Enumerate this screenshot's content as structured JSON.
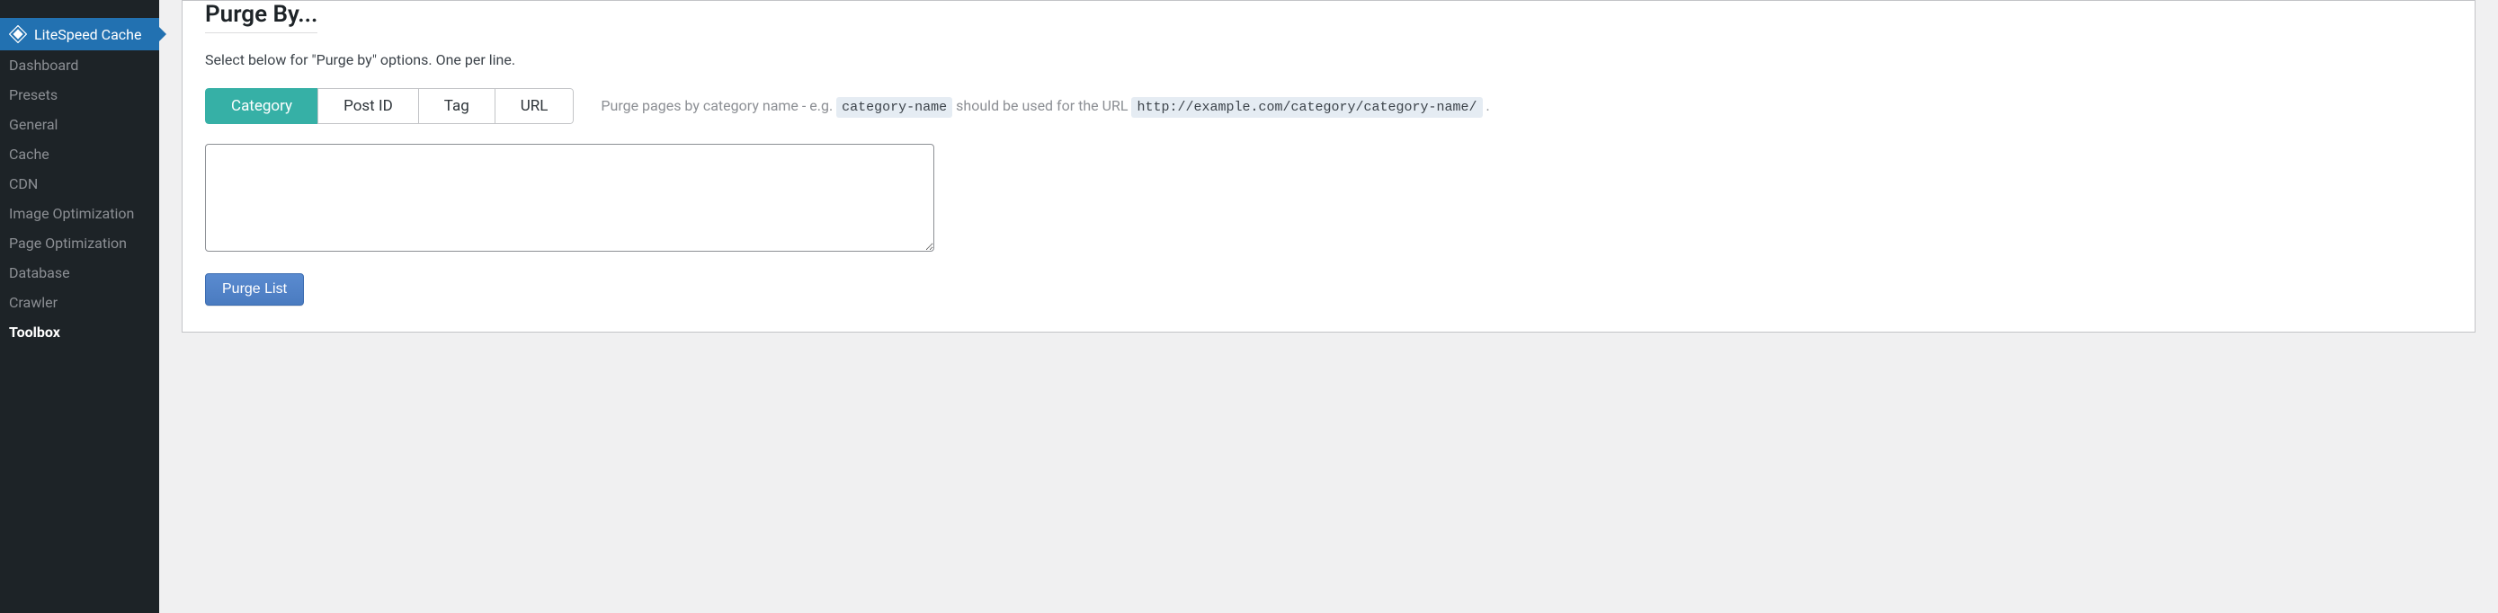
{
  "sidebar": {
    "header": "LiteSpeed Cache",
    "items": [
      {
        "label": "Dashboard"
      },
      {
        "label": "Presets"
      },
      {
        "label": "General"
      },
      {
        "label": "Cache"
      },
      {
        "label": "CDN"
      },
      {
        "label": "Image Optimization"
      },
      {
        "label": "Page Optimization"
      },
      {
        "label": "Database"
      },
      {
        "label": "Crawler"
      },
      {
        "label": "Toolbox"
      }
    ]
  },
  "main": {
    "title": "Purge By...",
    "subtitle": "Select below for \"Purge by\" options. One per line.",
    "tabs": [
      {
        "label": "Category",
        "active": true
      },
      {
        "label": "Post ID",
        "active": false
      },
      {
        "label": "Tag",
        "active": false
      },
      {
        "label": "URL",
        "active": false
      }
    ],
    "help": {
      "prefix": "Purge pages by category name - e.g. ",
      "code1": "category-name",
      "middle": " should be used for the URL ",
      "code2": "http://example.com/category/category-name/",
      "suffix": " ."
    },
    "textarea_value": "",
    "button_label": "Purge List"
  }
}
